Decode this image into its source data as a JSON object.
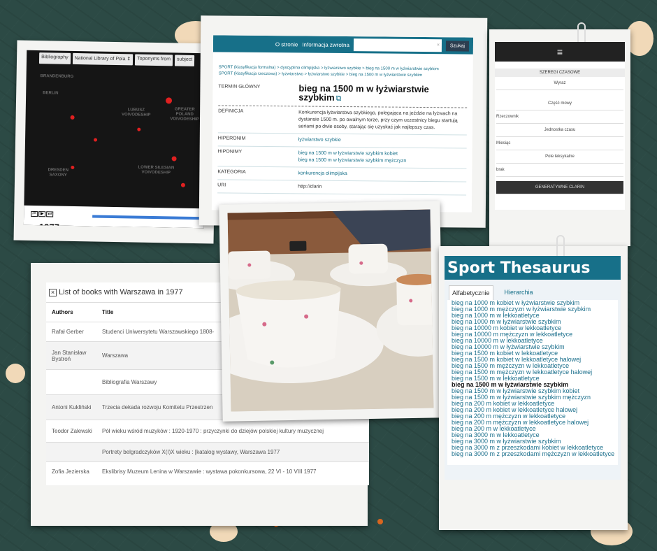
{
  "map": {
    "toolbar": [
      "Bibliography",
      "National Library of Pola ⇕",
      "Toponyms from",
      "subject"
    ],
    "regions": [
      "BRANDENBURG",
      "BERLIN",
      "LUBUSZ VOIVODESHIP",
      "GREATER POLAND VOIVODESHIP",
      "DRESDEN SAXONY",
      "LOWER SILESIAN VOIVODESHIP"
    ],
    "year": "1977"
  },
  "thesaurus": {
    "nav": [
      "O stronie",
      "Informacja zwrotna"
    ],
    "search_button": "Szukaj",
    "breadcrumb1": "SPORT (klasyfikacja formalna) > dyscyplina olimpijska > łyżwiarstwo szybkie > bieg na 1500 m w łyżwiarstwie szybkim",
    "breadcrumb2": "SPORT (klasyfikacja rzeczowa) > łyżwiarstwo > łyżwiarstwo szybkie > bieg na 1500 m w łyżwiarstwie szybkim",
    "term_label": "TERMIN GŁÓWNY",
    "term": "bieg na 1500 m w łyżwiarstwie szybkim",
    "def_label": "DEFINICJA",
    "definition": "Konkurencja łyżwiarstwa szybkiego, polegająca na jeździe na łyżwach na dystansie 1500 m. po owalnym torze, przy czym uczestnicy biegu startują seriami po dwie osoby, starając się uzyskać jak najlepszy czas.",
    "hyper_label": "HIPERONIM",
    "hyper": "łyżwiarstwo szybkie",
    "hypo_label": "HIPONIMY",
    "hypo1": "bieg na 1500 m w łyżwiarstwie szybkim kobiet",
    "hypo2": "bieg na 1500 m w łyżwiarstwie szybkim mężczyzn",
    "cat_label": "KATEGORIA",
    "category": "konkurencja olimpijska",
    "uri_label": "URI",
    "uri": "http://clarin"
  },
  "phone": {
    "menu": "≡",
    "header": "SZEREGI CZASOWE",
    "rows": [
      "Wyraz",
      "Część mowy",
      "Rzeczownik",
      "Jednostka czasu",
      "Miesiąc",
      "Pole leksykalne",
      "brak"
    ],
    "footer": "GENERATYWNE    CLARIN"
  },
  "books": {
    "title": "List of books with Warszawa in 1977",
    "headers": [
      "Authors",
      "Title"
    ],
    "rows": [
      {
        "author": "Rafał Gerber",
        "title": "Studenci Uniwersytetu Warszawskiego 1808-"
      },
      {
        "author": "Jan Stanisław Bystroń",
        "title": "Warszawa"
      },
      {
        "author": "",
        "title": "Bibliografia Warszawy"
      },
      {
        "author": "Antoni Kukliński",
        "title": "Trzecia dekada rozwoju Komitetu Przestrzen"
      },
      {
        "author": "Teodor Zalewski",
        "title": "Pół wieku wśród muzyków : 1920-1970 : przyczynki do dziejów polskiej kultury muzycznej"
      },
      {
        "author": "",
        "title": "Portrety belgradczyków X(I)X wieku : [katalog wystawy, Warszawa 1977"
      },
      {
        "author": "Zofia Jezierska",
        "title": "Ekslibrisy Muzeum Lenina w Warszawie : wystawa pokonkursowa, 22 VI - 10 VIII 1977"
      }
    ]
  },
  "sport": {
    "title": "Sport Thesaurus",
    "tabs": [
      "Alfabetycznie",
      "Hierarchia"
    ],
    "items": [
      "bieg na 1000 m kobiet w łyżwiarstwie szybkim",
      "bieg na 1000 m mężczyzn w łyżwiarstwie szybkim",
      "bieg na 1000 m w lekkoatletyce",
      "bieg na 1000 m w łyżwiarstwie szybkim",
      "bieg na 10000 m kobiet w lekkoatletyce",
      "bieg na 10000 m mężczyzn w lekkoatletyce",
      "bieg na 10000 m w lekkoatletyce",
      "bieg na 10000 m w łyżwiarstwie szybkim",
      "bieg na 1500 m kobiet w lekkoatletyce",
      "bieg na 1500 m kobiet w lekkoatletyce halowej",
      "bieg na 1500 m mężczyzn w lekkoatletyce",
      "bieg na 1500 m mężczyzn w lekkoatletyce halowej",
      "bieg na 1500 m w lekkoatletyce",
      "bieg na 1500 m w łyżwiarstwie szybkim",
      "bieg na 1500 m w łyżwiarstwie szybkim kobiet",
      "bieg na 1500 m w łyżwiarstwie szybkim mężczyzn",
      "bieg na 200 m kobiet w lekkoatletyce",
      "bieg na 200 m kobiet w lekkoatletyce halowej",
      "bieg na 200 m mężczyzn w lekkoatletyce",
      "bieg na 200 m mężczyzn w lekkoatletyce halowej",
      "bieg na 200 m w lekkoatletyce",
      "bieg na 3000 m w lekkoatletyce",
      "bieg na 3000 m w łyżwiarstwie szybkim",
      "bieg na 3000 m z przeszkodami kobiet w lekkoatletyce",
      "bieg na 3000 m z przeszkodami mężczyzn w lekkoatletyce"
    ],
    "selected_index": 13
  }
}
